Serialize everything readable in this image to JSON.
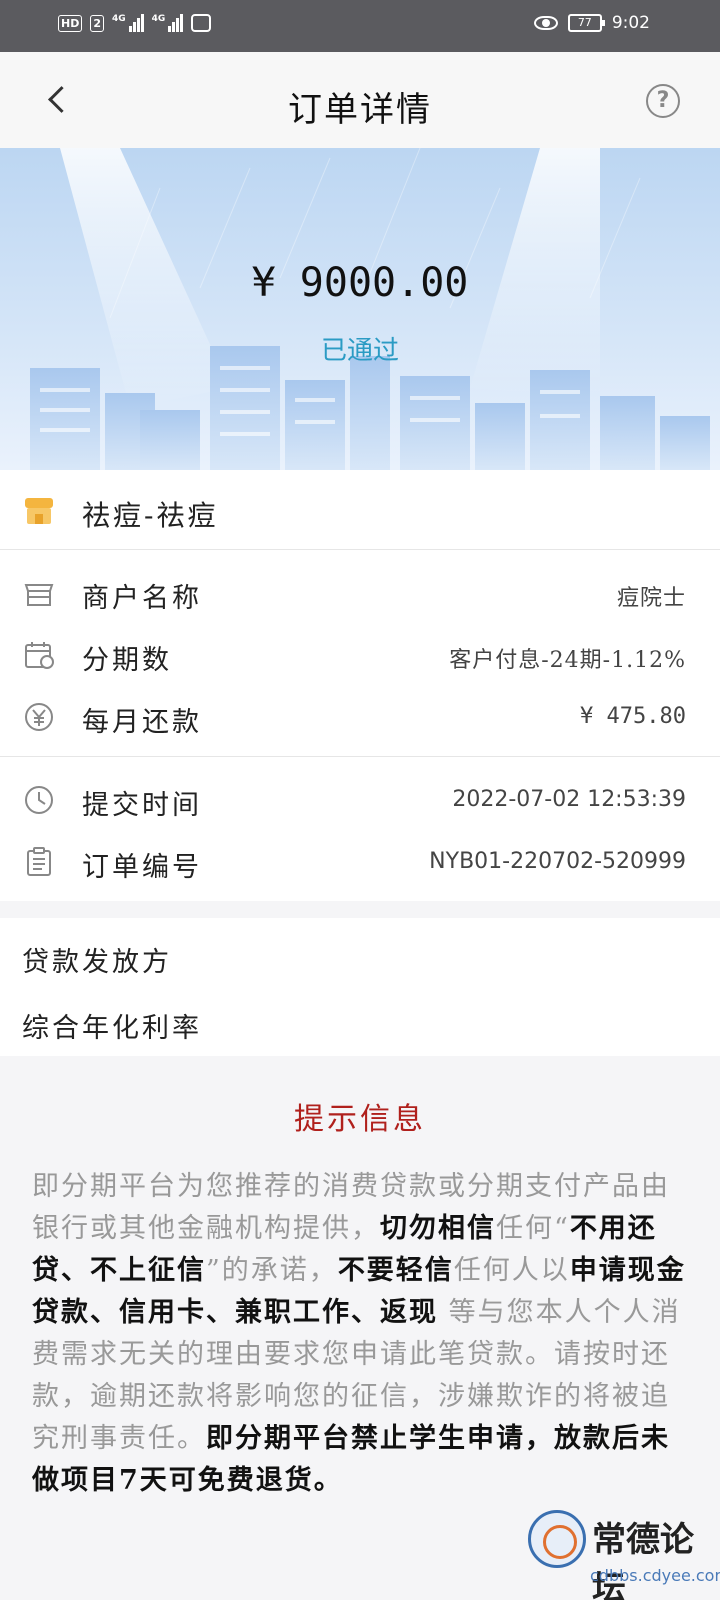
{
  "status_bar": {
    "left_chips": [
      "HD",
      "2"
    ],
    "signal_labels": [
      "4G",
      "4G"
    ],
    "battery": "77",
    "time": "9:02"
  },
  "header": {
    "title": "订单详情",
    "help_symbol": "?"
  },
  "banner": {
    "amount": "¥ 9000.00",
    "status": "已通过"
  },
  "product": {
    "name": "祛痘-祛痘"
  },
  "details": [
    {
      "label": "商户名称",
      "value": "痘院士",
      "icon": "store-icon"
    },
    {
      "label": "分期数",
      "value": "客户付息-24期-1.12%",
      "icon": "calendar-icon"
    },
    {
      "label": "每月还款",
      "value": "¥ 475.80",
      "icon": "yen-circle-icon"
    }
  ],
  "meta": [
    {
      "label": "提交时间",
      "value": "2022-07-02  12:53:39",
      "icon": "clock-icon"
    },
    {
      "label": "订单编号",
      "value": "NYB01-220702-520999",
      "icon": "clipboard-icon"
    }
  ],
  "loan": {
    "lender_label": "贷款发放方",
    "apr_label": "综合年化利率"
  },
  "notice": {
    "title": "提示信息",
    "segments": [
      {
        "text": "即分期平台为您推荐的消费贷款或分期支付产品由银行或其他金融机构提供，",
        "bold": false
      },
      {
        "text": "切勿相信",
        "bold": true
      },
      {
        "text": "任何“",
        "bold": false
      },
      {
        "text": "不用还贷、不上征信",
        "bold": true
      },
      {
        "text": "”的承诺，",
        "bold": false
      },
      {
        "text": "不要轻信",
        "bold": true
      },
      {
        "text": "任何人以",
        "bold": false
      },
      {
        "text": "申请现金贷款、信用卡、兼职工作、返现",
        "bold": true
      },
      {
        "text": " 等与您本人个人消费需求无关的理由要求您申请此笔贷款。请按时还款，逾期还款将影响您的征信，涉嫌欺诈的将被追究刑事责任。",
        "bold": false
      },
      {
        "text": "即分期平台禁止学生申请，放款后未做项目7天可免费退货。",
        "bold": true
      }
    ]
  },
  "watermark": {
    "text": "常德论坛",
    "url": "cdbbs.cdyee.com"
  },
  "colors": {
    "status_bar": "#5b5b5f",
    "status_accent": "#2b9bc4",
    "notice_title": "#b0201c",
    "shop_icon": "#f4b53f"
  }
}
